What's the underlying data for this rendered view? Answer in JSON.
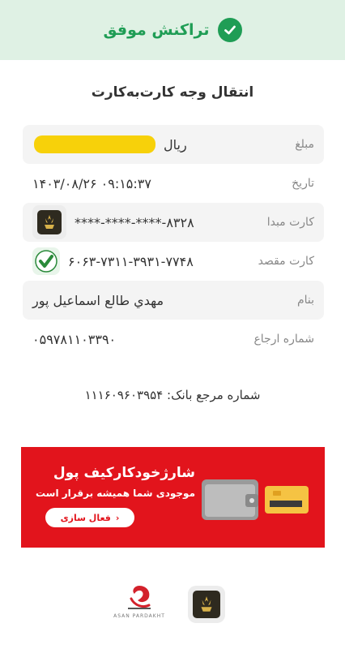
{
  "header": {
    "title": "تراکنش موفق",
    "icon": "check-circle-icon",
    "accent": "#1f9d55"
  },
  "page_title": "انتقال وجه کارت‌به‌کارت",
  "details": {
    "amount": {
      "label": "مبلغ",
      "unit": "ریال"
    },
    "date": {
      "label": "تاریخ",
      "value": "۰۹:۱۵:۳۷ ۱۴۰۳/۰۸/۲۶"
    },
    "source_card": {
      "label": "کارت مبدا",
      "value": "****-****-****-۸۳۲۸"
    },
    "dest_card": {
      "label": "کارت مقصد",
      "value": "۶۰۶۳-۷۳۱۱-۳۹۳۱-۷۷۴۸"
    },
    "name": {
      "label": "بنام",
      "value": "مهدي طالع اسماعيل پور"
    },
    "reference": {
      "label": "شماره ارجاع",
      "value": "۰۵۹۷۸۱۱۰۳۳۹۰"
    }
  },
  "bank_reference": "شماره مرجع بانک: ۱۱۱۶۰۹۶۰۳۹۵۴",
  "banner": {
    "title": "شارژخودکارکیف پول",
    "subtitle": "موجودی شما همیشه برقرار است",
    "button_label": "فعال سازی",
    "background": "#e2141c"
  },
  "footer": {
    "asan_label": "ASAN PARDAKHT"
  }
}
